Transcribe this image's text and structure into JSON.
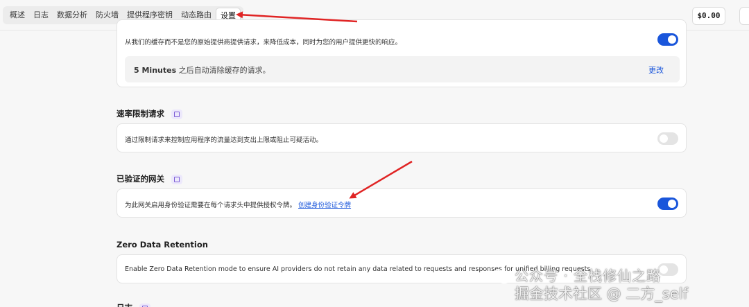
{
  "nav": {
    "tabs": [
      {
        "label": "概述",
        "active": false
      },
      {
        "label": "日志",
        "active": false
      },
      {
        "label": "数据分析",
        "active": false
      },
      {
        "label": "防火墙",
        "active": false
      },
      {
        "label": "提供程序密钥",
        "active": false
      },
      {
        "label": "动态路由",
        "active": false
      },
      {
        "label": "设置",
        "active": true
      }
    ],
    "balance": "$0.00"
  },
  "cache_card": {
    "description": "从我们的缓存而不是您的原始提供商提供请求，来降低成本，同时为您的用户提供更快的响应。",
    "toggle_on": true,
    "ttl_value": "5 Minutes",
    "ttl_suffix": " 之后自动清除缓存的请求。",
    "change_label": "更改"
  },
  "rate_limit": {
    "title": "速率限制请求",
    "description": "通过限制请求来控制应用程序的流量达到支出上限或阻止可疑活动。",
    "toggle_on": false
  },
  "auth_gateway": {
    "title": "已验证的网关",
    "description": "为此网关启用身份验证需要在每个请求头中提供授权令牌。",
    "link_label": "创建身份验证令牌",
    "toggle_on": true
  },
  "zdr": {
    "title": "Zero Data Retention",
    "description": "Enable Zero Data Retention mode to ensure AI providers do not retain any data related to requests and responses for unified billing requests.",
    "toggle_on": false
  },
  "next_section": {
    "title": "日志"
  },
  "watermark": {
    "line1": "公众号 · 全栈修仙之路",
    "line2": "掘金技术社区 @ 二方_self"
  },
  "colors": {
    "accent": "#1a56db",
    "annotation_arrow": "#e02424"
  }
}
